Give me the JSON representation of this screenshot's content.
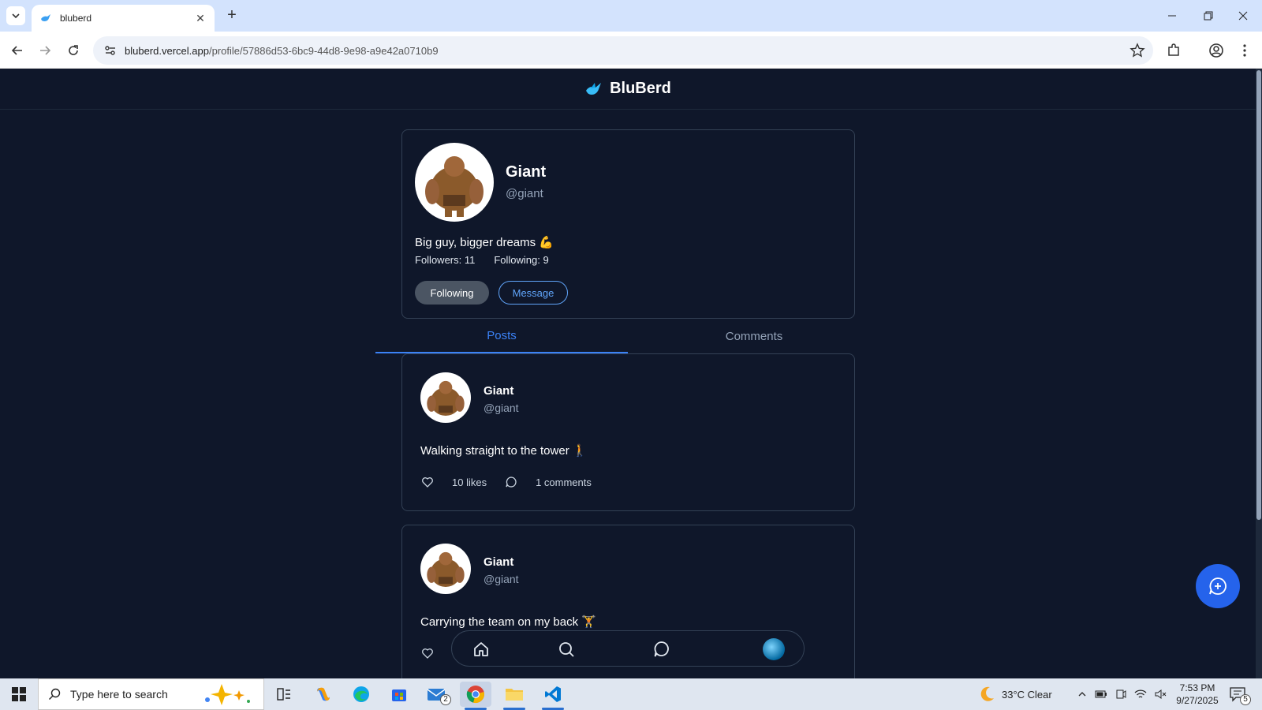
{
  "browser": {
    "tab_title": "bluberd",
    "url_host": "bluberd.vercel.app",
    "url_path": "/profile/57886d53-6bc9-44d8-9e98-a9e42a0710b9"
  },
  "app": {
    "brand": "BluBerd",
    "accent": "#3b82f6"
  },
  "profile": {
    "name": "Giant",
    "handle": "@giant",
    "bio": "Big guy, bigger dreams 💪",
    "followers": "Followers: 11",
    "following": "Following: 9",
    "following_button": "Following",
    "message_button": "Message"
  },
  "tabs": {
    "posts": "Posts",
    "comments": "Comments"
  },
  "posts": [
    {
      "name": "Giant",
      "handle": "@giant",
      "body": "Walking straight to the tower 🚶",
      "likes": "10 likes",
      "comments": "1 comments"
    },
    {
      "name": "Giant",
      "handle": "@giant",
      "body": "Carrying the team on my back 🏋"
    }
  ],
  "taskbar": {
    "search_placeholder": "Type here to search",
    "weather": "33°C  Clear",
    "time": "7:53 PM",
    "date": "9/27/2025",
    "mail_badge": "2",
    "notif_count": "5"
  }
}
